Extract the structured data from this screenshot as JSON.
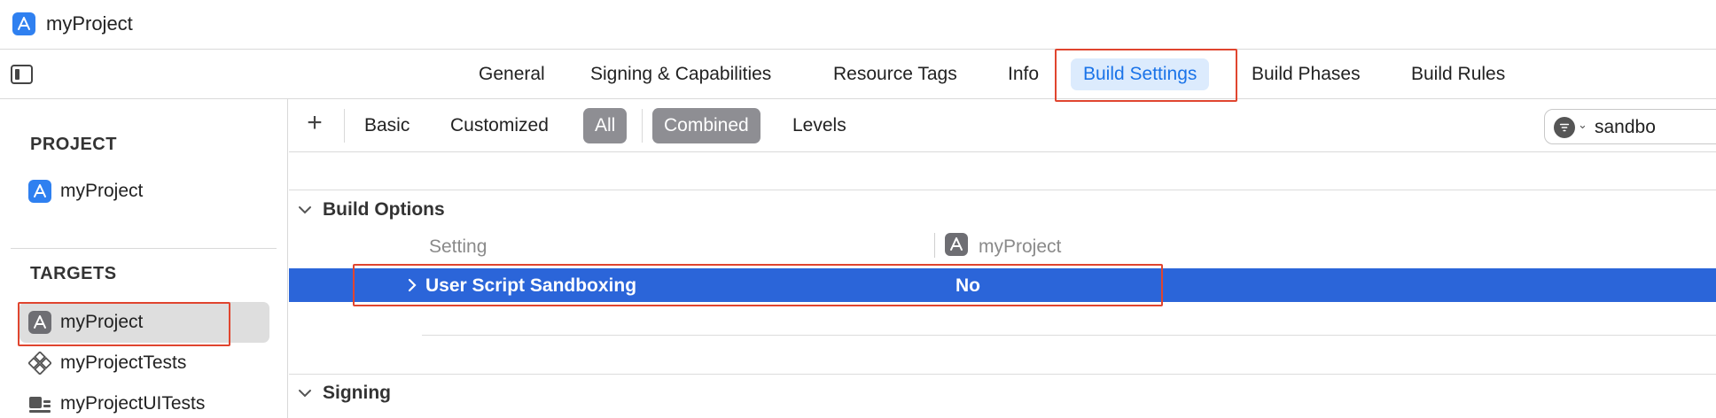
{
  "window": {
    "title": "myProject"
  },
  "tabs": [
    {
      "label": "General"
    },
    {
      "label": "Signing & Capabilities"
    },
    {
      "label": "Resource Tags"
    },
    {
      "label": "Info"
    },
    {
      "label": "Build Settings"
    },
    {
      "label": "Build Phases"
    },
    {
      "label": "Build Rules"
    }
  ],
  "active_tab": "Build Settings",
  "sidebar": {
    "project_header": "PROJECT",
    "project_items": [
      {
        "label": "myProject"
      }
    ],
    "targets_header": "TARGETS",
    "target_items": [
      {
        "label": "myProject",
        "selected": true
      },
      {
        "label": "myProjectTests"
      },
      {
        "label": "myProjectUITests"
      }
    ]
  },
  "filterbar": {
    "add_label": "+",
    "buttons": [
      {
        "label": "Basic"
      },
      {
        "label": "Customized"
      },
      {
        "label": "All",
        "selected": true
      },
      {
        "label": "Combined",
        "selected": true
      },
      {
        "label": "Levels"
      }
    ],
    "search_value": "sandbo"
  },
  "content": {
    "groups": [
      {
        "title": "Build Options",
        "columns": {
          "setting": "Setting",
          "target": "myProject"
        },
        "rows": [
          {
            "name": "User Script Sandboxing",
            "value": "No",
            "selected": true
          }
        ]
      },
      {
        "title": "Signing"
      }
    ]
  },
  "colors": {
    "accent": "#1a73e8",
    "selection_row": "#2b65d9",
    "highlight_border": "#e0452f",
    "app_icon_blue": "#2f80f0",
    "app_icon_gray": "#6e6e73"
  },
  "icons": {
    "app_icon": "xcode-app-icon",
    "target_icon": "app-target-icon",
    "tests_icon": "unit-tests-icon",
    "ui_tests_icon": "ui-tests-icon",
    "sidebar_toggle": "sidebar-toggle-icon",
    "filter": "filter-icon"
  }
}
